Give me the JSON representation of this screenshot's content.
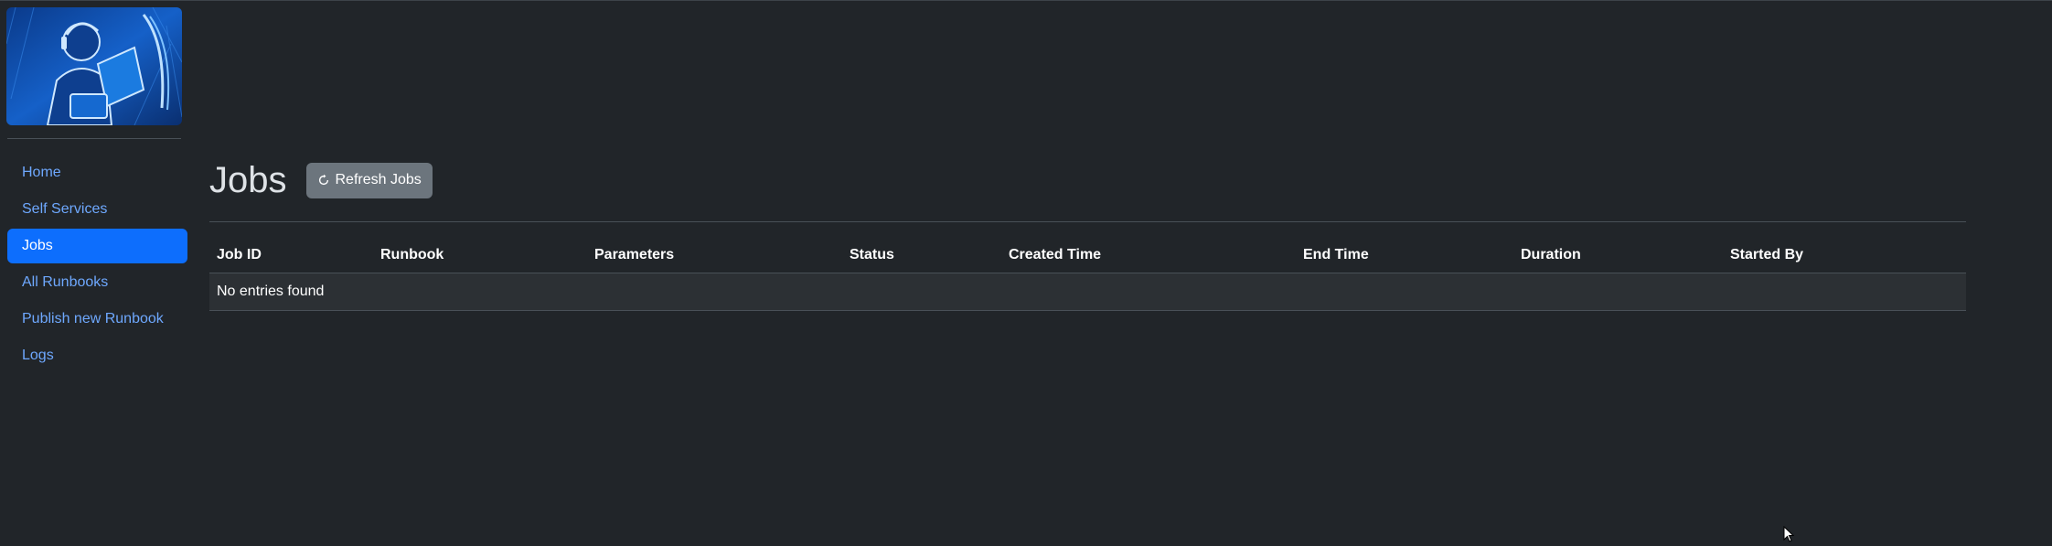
{
  "sidebar": {
    "logo_alt": "",
    "items": [
      {
        "label": "Home",
        "active": false
      },
      {
        "label": "Self Services",
        "active": false
      },
      {
        "label": "Jobs",
        "active": true
      },
      {
        "label": "All Runbooks",
        "active": false
      },
      {
        "label": "Publish new Runbook",
        "active": false
      },
      {
        "label": "Logs",
        "active": false
      }
    ]
  },
  "page": {
    "title": "Jobs",
    "refresh_label": "Refresh Jobs",
    "refresh_icon": "refresh-icon"
  },
  "table": {
    "columns": [
      "Job ID",
      "Runbook",
      "Parameters",
      "Status",
      "Created Time",
      "End Time",
      "Duration",
      "Started By"
    ],
    "empty_text": "No entries found"
  },
  "colors": {
    "background": "#212529",
    "accent": "#0d6efd",
    "link": "#6ea8fe",
    "button": "#6c757d"
  }
}
